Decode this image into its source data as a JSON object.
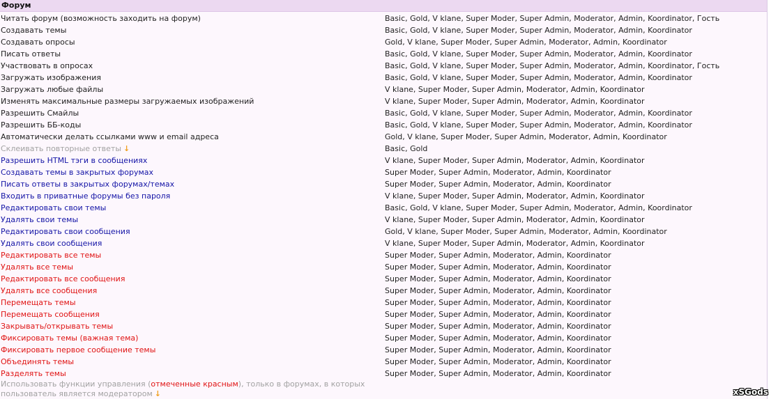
{
  "header": {
    "title": "Форум"
  },
  "rows": [
    {
      "label": "Читать форум (возможность заходить на форум)",
      "groups": "Basic, Gold, V klane, Super Moder, Super Admin, Moderator, Admin, Koordinator, Гость",
      "style": "normal"
    },
    {
      "label": "Создавать темы",
      "groups": "Basic, Gold, V klane, Super Moder, Super Admin, Moderator, Admin, Koordinator",
      "style": "normal"
    },
    {
      "label": "Создавать опросы",
      "groups": "Gold, V klane, Super Moder, Super Admin, Moderator, Admin, Koordinator",
      "style": "normal"
    },
    {
      "label": "Писать ответы",
      "groups": "Basic, Gold, V klane, Super Moder, Super Admin, Moderator, Admin, Koordinator",
      "style": "normal"
    },
    {
      "label": "Участвовать в опросах",
      "groups": "Basic, Gold, V klane, Super Moder, Super Admin, Moderator, Admin, Koordinator, Гость",
      "style": "normal"
    },
    {
      "label": "Загружать изображения",
      "groups": "Basic, Gold, V klane, Super Moder, Super Admin, Moderator, Admin, Koordinator",
      "style": "normal"
    },
    {
      "label": "Загружать любые файлы",
      "groups": "V klane, Super Moder, Super Admin, Moderator, Admin, Koordinator",
      "style": "normal"
    },
    {
      "label": "Изменять максимальные размеры загружаемых изображений",
      "groups": "V klane, Super Moder, Super Admin, Moderator, Admin, Koordinator",
      "style": "normal"
    },
    {
      "label": "Разрешить Смайлы",
      "groups": "Basic, Gold, V klane, Super Moder, Super Admin, Moderator, Admin, Koordinator",
      "style": "normal"
    },
    {
      "label": "Разрешить ББ-коды",
      "groups": "Basic, Gold, V klane, Super Moder, Super Admin, Moderator, Admin, Koordinator",
      "style": "normal"
    },
    {
      "label": "Автоматически делать ссылками www и email адреса",
      "groups": "Gold, V klane, Super Moder, Super Admin, Moderator, Admin, Koordinator",
      "style": "normal"
    },
    {
      "label": "Склеивать повторные ответы",
      "groups": "Basic, Gold",
      "style": "gray",
      "arrow": "↓"
    },
    {
      "label": "Разрешить HTML тэги в сообщениях",
      "groups": "V klane, Super Moder, Super Admin, Moderator, Admin, Koordinator",
      "style": "blue"
    },
    {
      "label": "Создавать темы в закрытых форумах",
      "groups": "Super Moder, Super Admin, Moderator, Admin, Koordinator",
      "style": "blue"
    },
    {
      "label": "Писать ответы в закрытых форумах/темах",
      "groups": "Super Moder, Super Admin, Moderator, Admin, Koordinator",
      "style": "blue"
    },
    {
      "label": "Входить в приватные форумы без пароля",
      "groups": "V klane, Super Moder, Super Admin, Moderator, Admin, Koordinator",
      "style": "blue"
    },
    {
      "label": "Редактировать свои темы",
      "groups": "Basic, Gold, V klane, Super Moder, Super Admin, Moderator, Admin, Koordinator",
      "style": "blue"
    },
    {
      "label": "Удалять свои темы",
      "groups": "V klane, Super Moder, Super Admin, Moderator, Admin, Koordinator",
      "style": "blue"
    },
    {
      "label": "Редактировать свои сообщения",
      "groups": "Gold, V klane, Super Moder, Super Admin, Moderator, Admin, Koordinator",
      "style": "blue"
    },
    {
      "label": "Удалять свои сообщения",
      "groups": "V klane, Super Moder, Super Admin, Moderator, Admin, Koordinator",
      "style": "blue"
    },
    {
      "label": "Редактировать все темы",
      "groups": "Super Moder, Super Admin, Moderator, Admin, Koordinator",
      "style": "red"
    },
    {
      "label": "Удалять все темы",
      "groups": "Super Moder, Super Admin, Moderator, Admin, Koordinator",
      "style": "red"
    },
    {
      "label": "Редактировать все сообщения",
      "groups": "Super Moder, Super Admin, Moderator, Admin, Koordinator",
      "style": "red"
    },
    {
      "label": "Удалять все сообщения",
      "groups": "Super Moder, Super Admin, Moderator, Admin, Koordinator",
      "style": "red"
    },
    {
      "label": "Перемещать темы",
      "groups": "Super Moder, Super Admin, Moderator, Admin, Koordinator",
      "style": "red"
    },
    {
      "label": "Перемещать сообщения",
      "groups": "Super Moder, Super Admin, Moderator, Admin, Koordinator",
      "style": "red"
    },
    {
      "label": "Закрывать/открывать темы",
      "groups": "Super Moder, Super Admin, Moderator, Admin, Koordinator",
      "style": "red"
    },
    {
      "label": "Фиксировать темы (важная тема)",
      "groups": "Super Moder, Super Admin, Moderator, Admin, Koordinator",
      "style": "red"
    },
    {
      "label": "Фиксировать первое сообщение темы",
      "groups": "Super Moder, Super Admin, Moderator, Admin, Koordinator",
      "style": "red"
    },
    {
      "label": "Объединять темы",
      "groups": "Super Moder, Super Admin, Moderator, Admin, Koordinator",
      "style": "red"
    },
    {
      "label": "Разделять темы",
      "groups": "Super Moder, Super Admin, Moderator, Admin, Koordinator",
      "style": "red"
    }
  ],
  "note": {
    "text_before": "Использовать функции управления (",
    "text_red": "отмеченные красным",
    "text_after": "), только в форумах, в которых пользователь является модератором",
    "arrow": "↓"
  },
  "watermark": "xSGods",
  "colors": {
    "normal": "#222222",
    "gray": "#a2a2a2",
    "blue": "#1414a6",
    "red": "#e01414",
    "header_bg": "#ecd9f1",
    "panel_bg": "#fdf7fd",
    "arrow": "#f0a020"
  }
}
